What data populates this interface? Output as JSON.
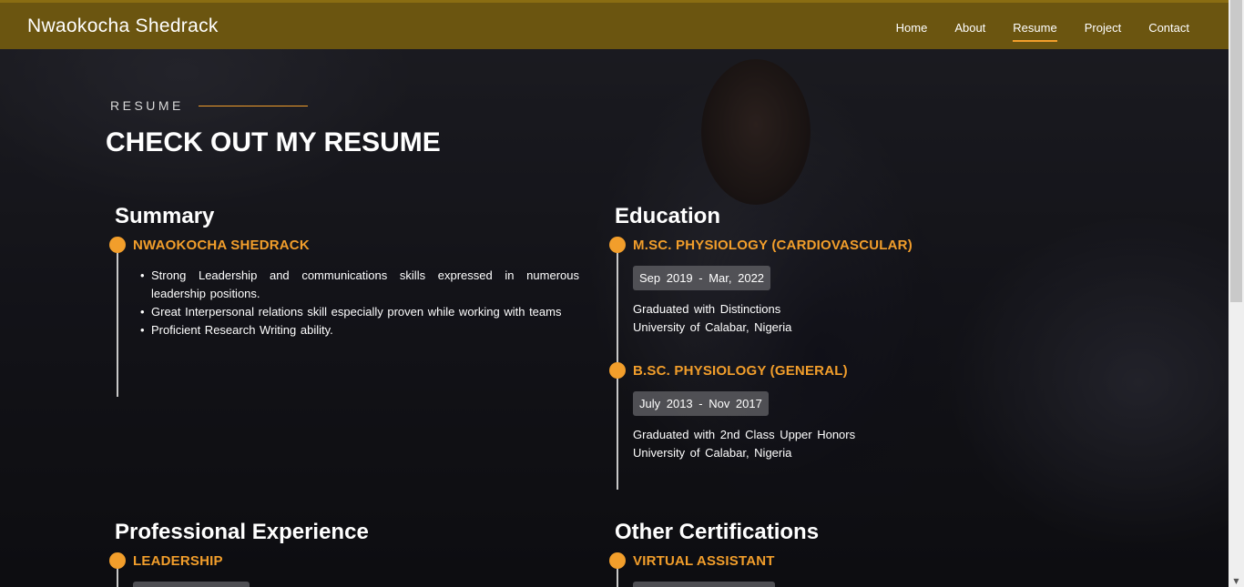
{
  "header": {
    "brand": "Nwaokocha Shedrack",
    "nav": [
      "Home",
      "About",
      "Resume",
      "Project",
      "Contact"
    ],
    "active": "Resume"
  },
  "section": {
    "label": "RESUME",
    "title": "CHECK OUT MY RESUME"
  },
  "summary": {
    "heading": "Summary",
    "name": "NWAOKOCHA SHEDRACK",
    "points": [
      "Strong Leadership and communications skills expressed in numerous leadership positions.",
      "Great Interpersonal relations skill especially proven while working with teams",
      "Proficient Research Writing ability."
    ]
  },
  "education": {
    "heading": "Education",
    "items": [
      {
        "title": "M.SC. PHYSIOLOGY (CARDIOVASCULAR)",
        "date": "Sep 2019 - Mar, 2022",
        "line1": "Graduated with Distinctions",
        "line2": "University of Calabar, Nigeria"
      },
      {
        "title": "B.SC. PHYSIOLOGY (GENERAL)",
        "date": "July 2013 - Nov 2017",
        "line1": "Graduated with 2nd Class Upper Honors",
        "line2": "University of Calabar, Nigeria"
      }
    ]
  },
  "experience": {
    "heading": "Professional Experience",
    "items": [
      {
        "title": "LEADERSHIP"
      }
    ]
  },
  "certifications": {
    "heading": "Other Certifications",
    "items": [
      {
        "title": "VIRTUAL ASSISTANT"
      }
    ]
  },
  "colors": {
    "accent": "#f29e2b",
    "header_bg": "#6b5510"
  }
}
